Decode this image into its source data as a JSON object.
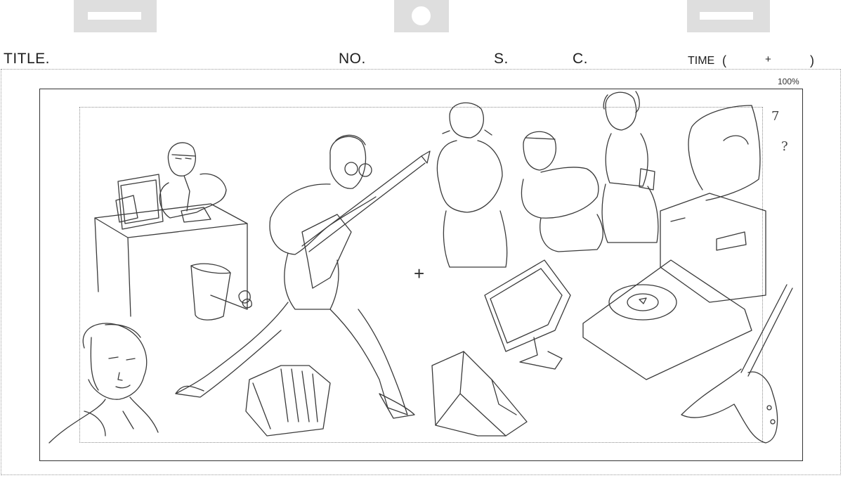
{
  "header": {
    "title_label": "TITLE.",
    "no_label": "NO.",
    "s_label": "S.",
    "c_label": "C.",
    "time_label": "TIME",
    "time_open": "(",
    "time_plus": "+",
    "time_close": ")"
  },
  "frame": {
    "zoom": "100%",
    "center_mark": "+"
  },
  "sketch": {
    "annotations": [
      "7",
      "?"
    ]
  }
}
